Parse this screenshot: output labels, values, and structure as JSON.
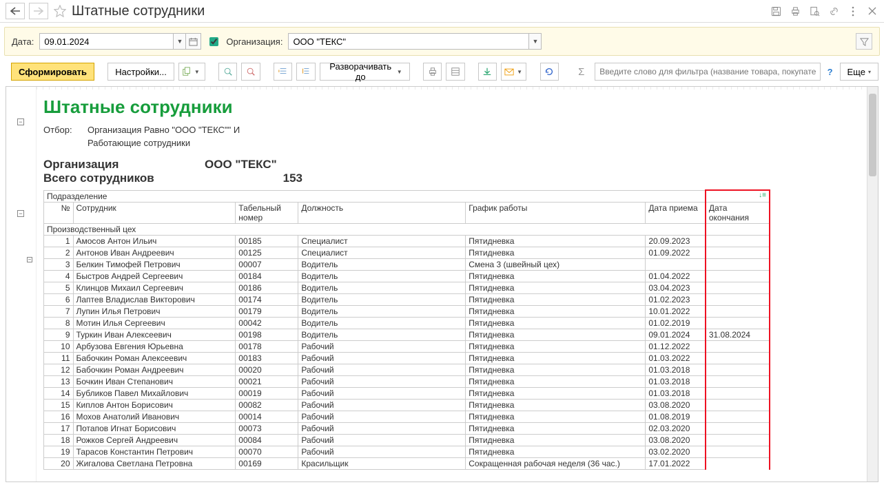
{
  "title": "Штатные сотрудники",
  "filter": {
    "date_label": "Дата:",
    "date_value": "09.01.2024",
    "org_checked": true,
    "org_label": "Организация:",
    "org_value": "ООО \"ТЕКС\""
  },
  "toolbar": {
    "form_label": "Сформировать",
    "settings_label": "Настройки...",
    "expand_label": "Разворачивать до",
    "filter_placeholder": "Введите слово для фильтра (название товара, покупателя и ...",
    "more_label": "Еще"
  },
  "report": {
    "title": "Штатные сотрудники",
    "filter_label": "Отбор:",
    "filter_value_1": "Организация Равно \"ООО \"ТЕКС\"\" И",
    "filter_value_2": "Работающие сотрудники",
    "org_key": "Организация",
    "org_val": "ООО \"ТЕКС\"",
    "total_key": "Всего сотрудников",
    "total_val": "153",
    "section_header": "Подразделение",
    "columns": {
      "num": "№",
      "employee": "Сотрудник",
      "tab_num": "Табельный номер",
      "position": "Должность",
      "schedule": "График работы",
      "hire_date": "Дата приема",
      "end_date": "Дата окончания"
    },
    "department": "Производственный цех",
    "rows": [
      {
        "n": "1",
        "name": "Амосов Антон Ильич",
        "tab": "00185",
        "pos": "Специалист",
        "sched": "Пятидневка",
        "hire": "20.09.2023",
        "end": ""
      },
      {
        "n": "2",
        "name": "Антонов Иван Андреевич",
        "tab": "00125",
        "pos": "Специалист",
        "sched": "Пятидневка",
        "hire": "01.09.2022",
        "end": ""
      },
      {
        "n": "3",
        "name": "Белкин Тимофей Петрович",
        "tab": "00007",
        "pos": "Водитель",
        "sched": "Смена 3 (швейный цех)",
        "hire": "",
        "end": ""
      },
      {
        "n": "4",
        "name": "Быстров Андрей Сергеевич",
        "tab": "00184",
        "pos": "Водитель",
        "sched": "Пятидневка",
        "hire": "01.04.2022",
        "end": ""
      },
      {
        "n": "5",
        "name": "Клинцов Михаил Сергеевич",
        "tab": "00186",
        "pos": "Водитель",
        "sched": "Пятидневка",
        "hire": "03.04.2023",
        "end": ""
      },
      {
        "n": "6",
        "name": "Лаптев Владислав Викторович",
        "tab": "00174",
        "pos": "Водитель",
        "sched": "Пятидневка",
        "hire": "01.02.2023",
        "end": ""
      },
      {
        "n": "7",
        "name": "Лупин Илья Петрович",
        "tab": "00179",
        "pos": "Водитель",
        "sched": "Пятидневка",
        "hire": "10.01.2022",
        "end": ""
      },
      {
        "n": "8",
        "name": "Мотин Илья Сергеевич",
        "tab": "00042",
        "pos": "Водитель",
        "sched": "Пятидневка",
        "hire": "01.02.2019",
        "end": ""
      },
      {
        "n": "9",
        "name": "Туркин Иван Алексеевич",
        "tab": "00198",
        "pos": "Водитель",
        "sched": "Пятидневка",
        "hire": "09.01.2024",
        "end": "31.08.2024"
      },
      {
        "n": "10",
        "name": "Арбузова Евгения Юрьевна",
        "tab": "00178",
        "pos": "Рабочий",
        "sched": "Пятидневка",
        "hire": "01.12.2022",
        "end": ""
      },
      {
        "n": "11",
        "name": "Бабочкин Роман Алексеевич",
        "tab": "00183",
        "pos": "Рабочий",
        "sched": "Пятидневка",
        "hire": "01.03.2022",
        "end": ""
      },
      {
        "n": "12",
        "name": "Бабочкин Роман Андреевич",
        "tab": "00020",
        "pos": "Рабочий",
        "sched": "Пятидневка",
        "hire": "01.03.2018",
        "end": ""
      },
      {
        "n": "13",
        "name": "Бочкин Иван Степанович",
        "tab": "00021",
        "pos": "Рабочий",
        "sched": "Пятидневка",
        "hire": "01.03.2018",
        "end": ""
      },
      {
        "n": "14",
        "name": "Бубликов Павел Михайлович",
        "tab": "00019",
        "pos": "Рабочий",
        "sched": "Пятидневка",
        "hire": "01.03.2018",
        "end": ""
      },
      {
        "n": "15",
        "name": "Киплов Антон Борисович",
        "tab": "00082",
        "pos": "Рабочий",
        "sched": "Пятидневка",
        "hire": "03.08.2020",
        "end": ""
      },
      {
        "n": "16",
        "name": "Мохов Анатолий Иванович",
        "tab": "00014",
        "pos": "Рабочий",
        "sched": "Пятидневка",
        "hire": "01.08.2019",
        "end": ""
      },
      {
        "n": "17",
        "name": "Потапов Игнат Борисович",
        "tab": "00073",
        "pos": "Рабочий",
        "sched": "Пятидневка",
        "hire": "02.03.2020",
        "end": ""
      },
      {
        "n": "18",
        "name": "Рожков Сергей Андреевич",
        "tab": "00084",
        "pos": "Рабочий",
        "sched": "Пятидневка",
        "hire": "03.08.2020",
        "end": ""
      },
      {
        "n": "19",
        "name": "Тарасов Константин Петрович",
        "tab": "00070",
        "pos": "Рабочий",
        "sched": "Пятидневка",
        "hire": "03.02.2020",
        "end": ""
      },
      {
        "n": "20",
        "name": "Жигалова Светлана Петровна",
        "tab": "00169",
        "pos": "Красильщик",
        "sched": "Сокращенная рабочая неделя (36 час.)",
        "hire": "17.01.2022",
        "end": ""
      }
    ]
  }
}
